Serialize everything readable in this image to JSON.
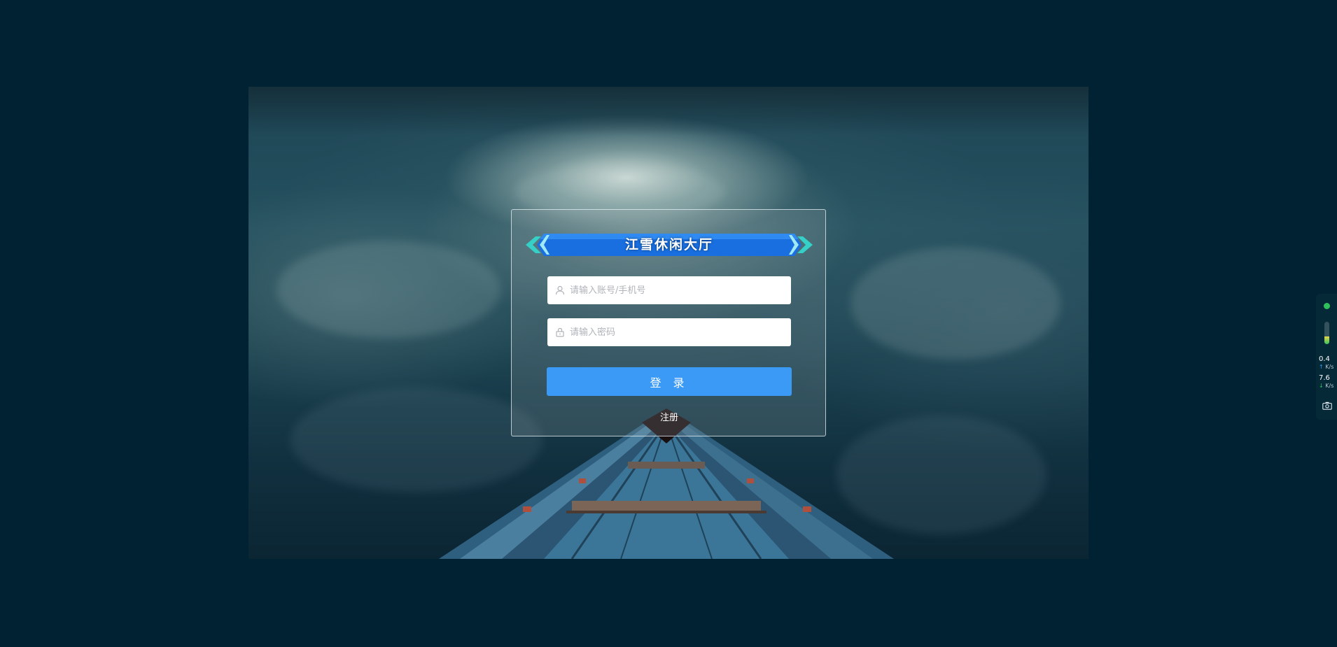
{
  "app": {
    "title": "江雪休闲大厅"
  },
  "login_form": {
    "account_placeholder": "请输入账号/手机号",
    "password_placeholder": "请输入密码",
    "login_label": "登 录",
    "register_label": "注册"
  },
  "icons": {
    "account": "user-icon",
    "password": "lock-icon",
    "status": "status-dot-icon",
    "screenshot": "camera-icon"
  },
  "system_monitor": {
    "upload_speed": "0.4",
    "upload_unit": "K/s",
    "download_speed": "7.6",
    "download_unit": "K/s",
    "usage_fraction": 0.35
  },
  "colors": {
    "page_background": "#012233",
    "login_button": "#3b9af5",
    "title_banner": "#1a6fe0",
    "status_dot": "#2fc25b"
  }
}
